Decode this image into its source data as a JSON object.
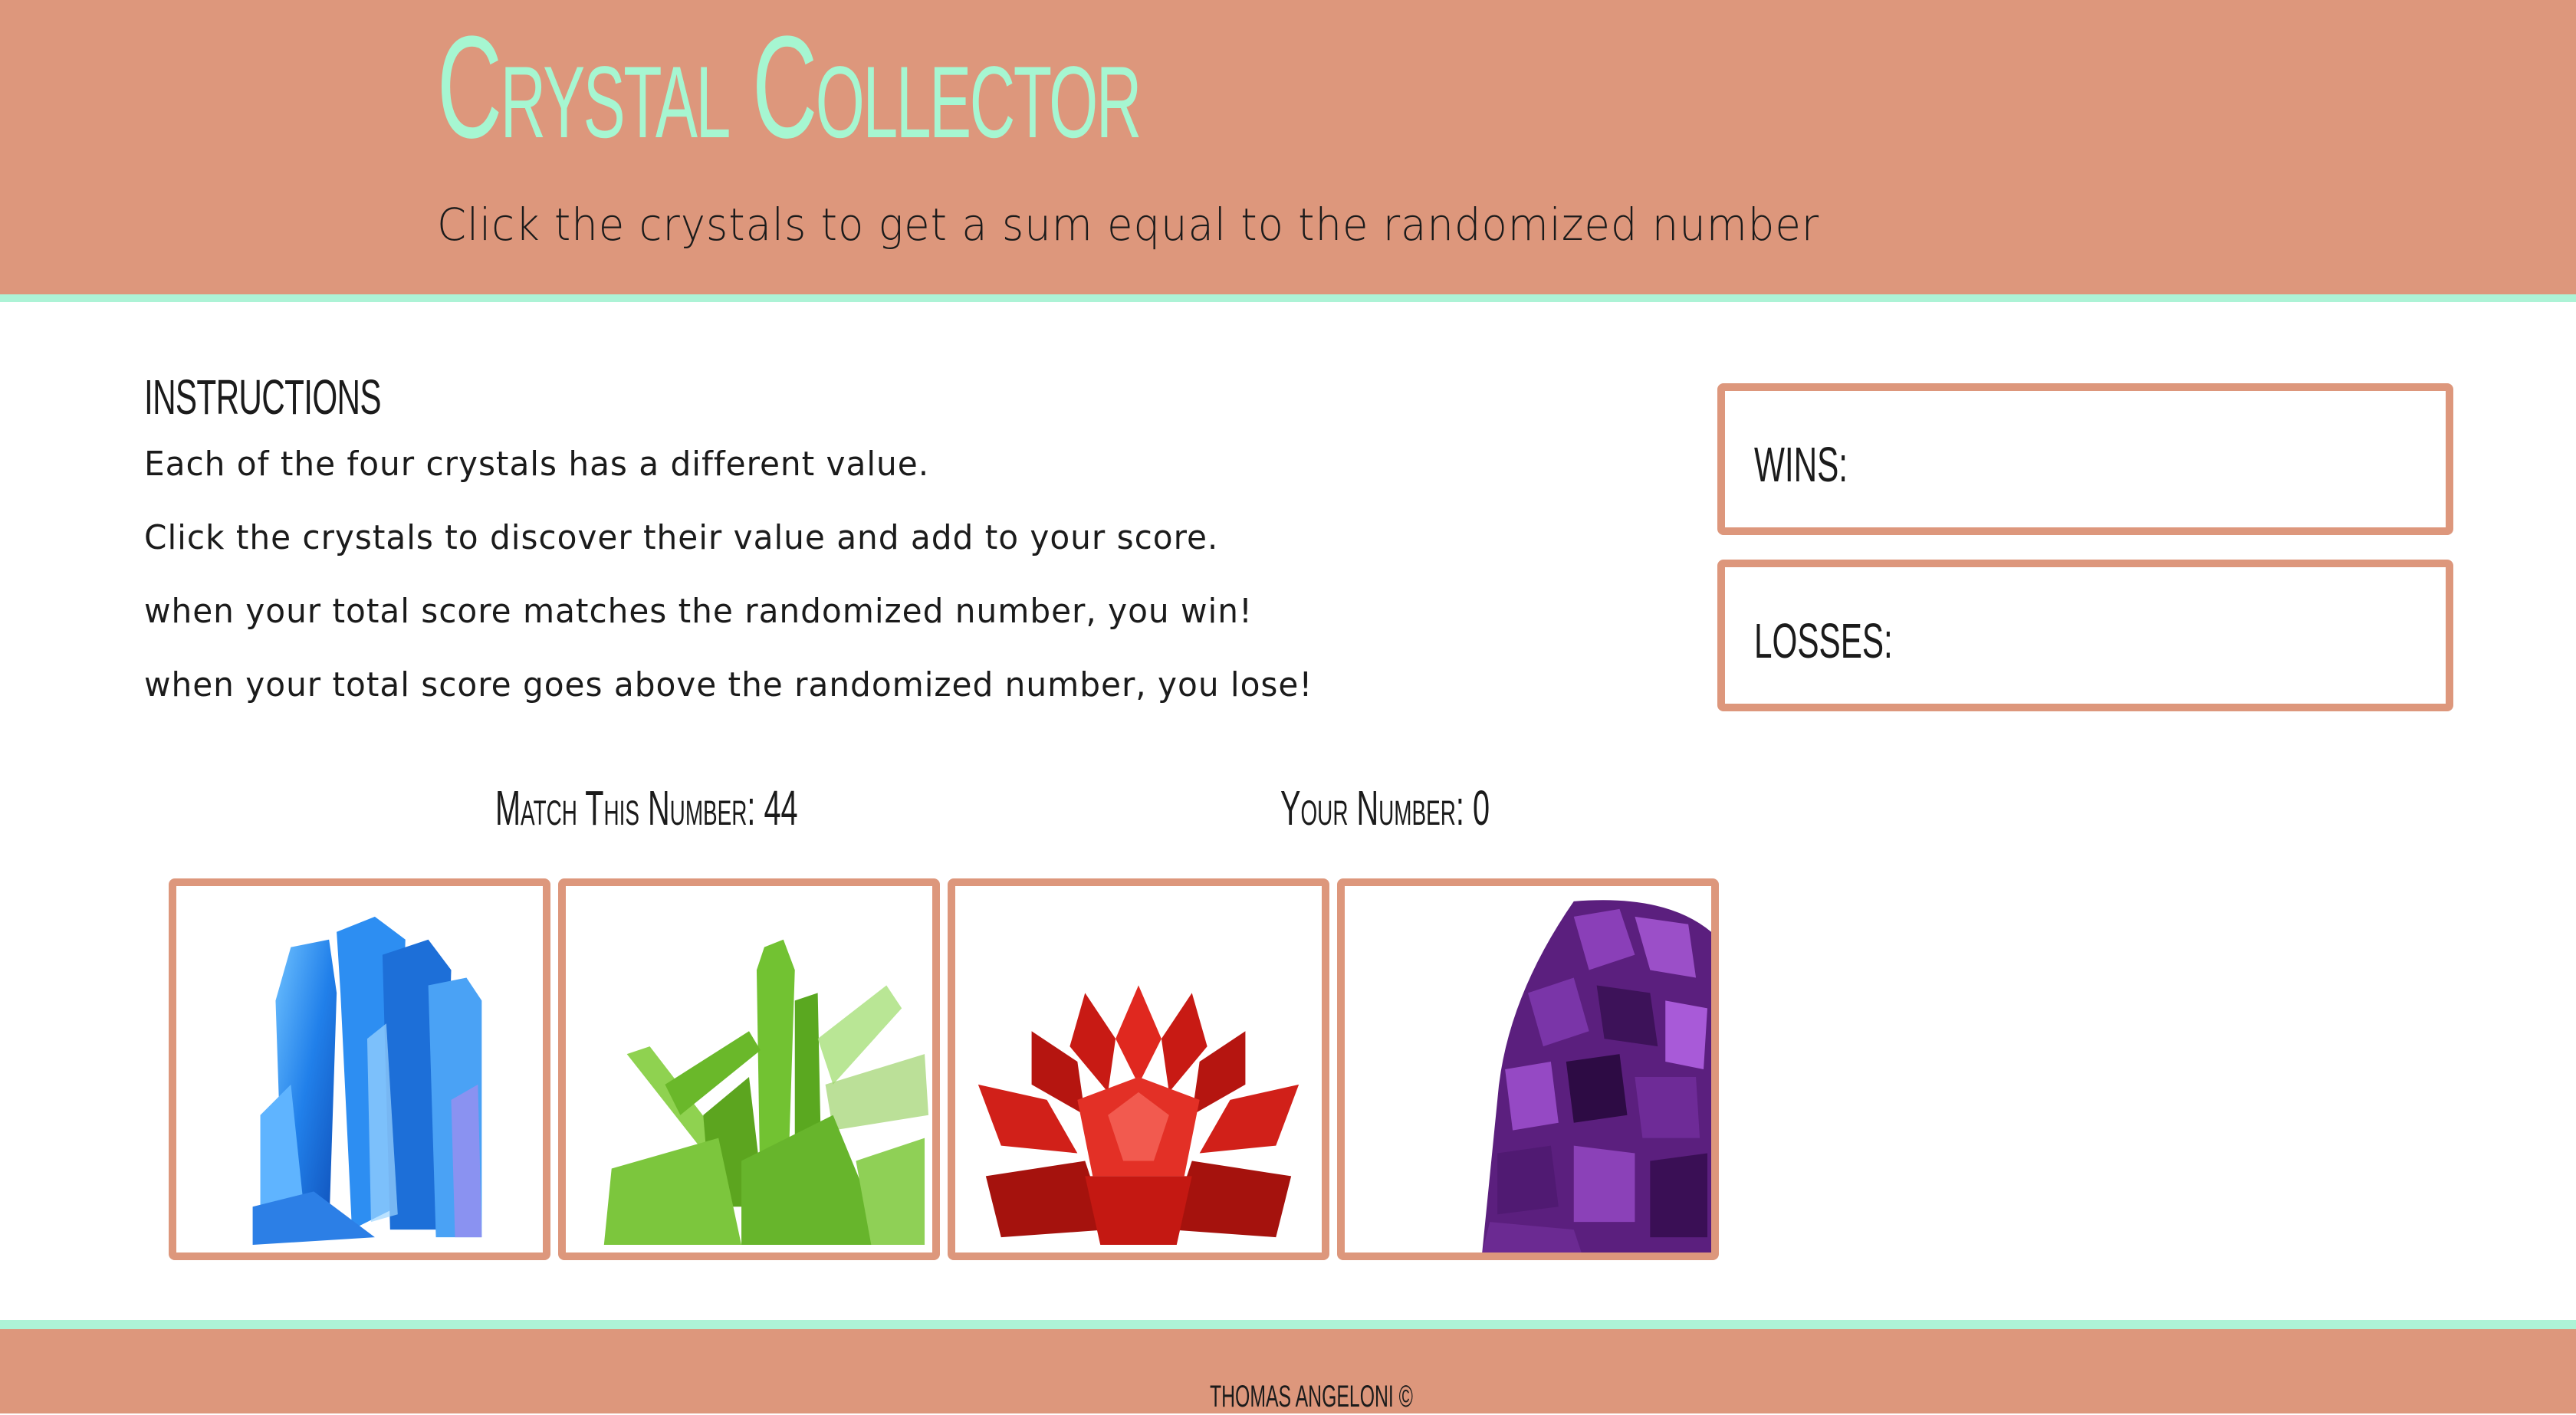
{
  "header": {
    "title": "Crystal Collector",
    "subtitle": "Click the crystals to get a sum equal to the randomized number"
  },
  "instructions": {
    "heading": "INSTRUCTIONS",
    "lines": [
      "Each of the four crystals has a different value.",
      "Click the crystals to discover their value and add to your score.",
      "when your total score matches the randomized number, you win!",
      "when your total score goes above the randomized number, you lose!"
    ]
  },
  "scoreboard": {
    "wins_label": "WINS:",
    "losses_label": "LOSSES:"
  },
  "game": {
    "target_label": "Match This Number: 44",
    "target_value": 44,
    "your_label": "Your Number: 0",
    "your_value": 0,
    "crystals": [
      {
        "name": "blue-crystal",
        "color": "#2e8ff0"
      },
      {
        "name": "green-crystal",
        "color": "#6fbf2e"
      },
      {
        "name": "red-crystal",
        "color": "#d8211c"
      },
      {
        "name": "purple-crystal",
        "color": "#6a2590"
      }
    ]
  },
  "footer": {
    "credit": "THOMAS ANGELONI ©"
  },
  "colors": {
    "accent": "#dd977c",
    "mint": "#adf3d6",
    "title": "#a6f6d1"
  }
}
